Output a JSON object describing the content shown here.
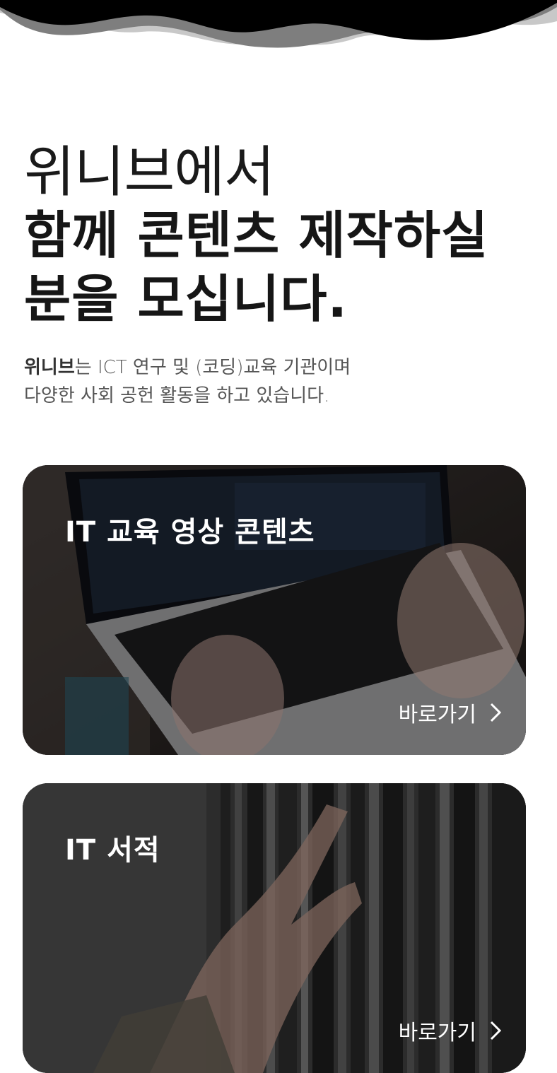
{
  "hero": {
    "line1": "위니브에서",
    "line2": "함께 콘텐츠 제작하실",
    "line3": "분을 모십니다."
  },
  "intro": {
    "brand": "위니브",
    "line1_rest": "는 ICT 연구 및 (코딩)교육 기관이며",
    "line2": "다양한 사회 공헌 활동을 하고 있습니다."
  },
  "cards": [
    {
      "title": "IT 교육 영상 콘텐츠",
      "link_label": "바로가기",
      "icon": "chevron-right-icon"
    },
    {
      "title": "IT 서적",
      "link_label": "바로가기",
      "icon": "chevron-right-icon"
    }
  ]
}
